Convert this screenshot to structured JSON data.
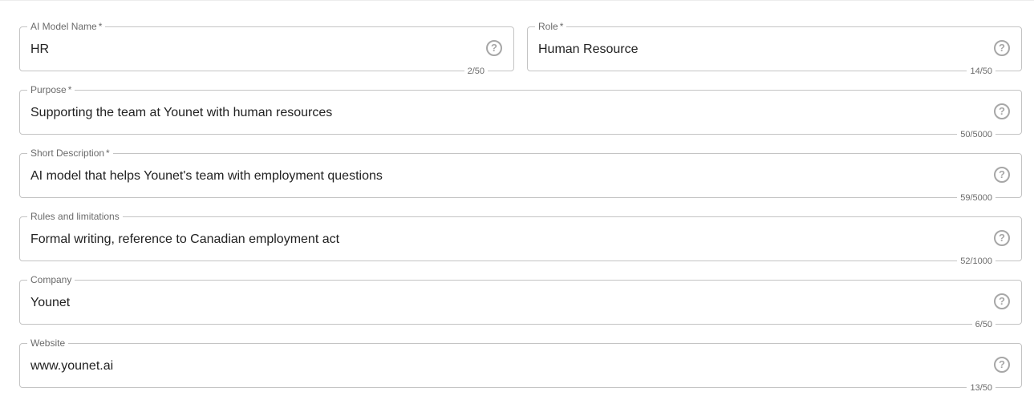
{
  "form": {
    "ai_model_name": {
      "label": "AI Model Name",
      "required_mark": "*",
      "value": "HR",
      "counter": "2/50",
      "help_glyph": "?"
    },
    "role": {
      "label": "Role",
      "required_mark": "*",
      "value": "Human Resource",
      "counter": "14/50",
      "help_glyph": "?"
    },
    "purpose": {
      "label": "Purpose",
      "required_mark": "*",
      "value": "Supporting the team at Younet with human resources",
      "counter": "50/5000",
      "help_glyph": "?"
    },
    "short_description": {
      "label": "Short Description",
      "required_mark": "*",
      "value": "AI model that helps Younet's team with employment questions",
      "counter": "59/5000",
      "help_glyph": "?"
    },
    "rules": {
      "label": "Rules and limitations",
      "value": "Formal writing, reference to Canadian employment act",
      "counter": "52/1000",
      "help_glyph": "?"
    },
    "company": {
      "label": "Company",
      "value": "Younet",
      "counter": "6/50",
      "help_glyph": "?"
    },
    "website": {
      "label": "Website",
      "value": "www.younet.ai",
      "counter": "13/50",
      "help_glyph": "?"
    }
  },
  "icons": {
    "help": "help-circle-icon"
  },
  "colors": {
    "border": "#c4c4c4",
    "label": "#6b6b6b",
    "text": "#222222",
    "icon": "#a7a7a7"
  }
}
